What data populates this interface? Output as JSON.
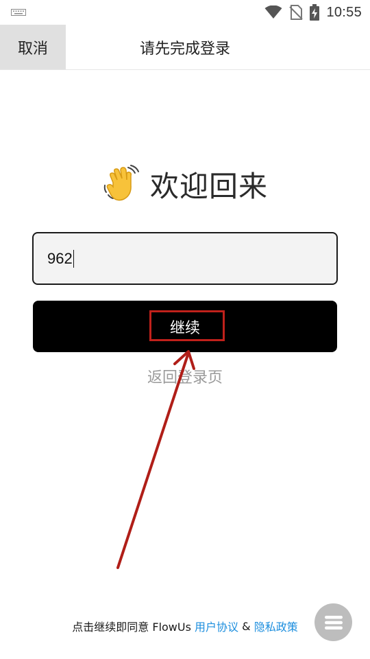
{
  "status_bar": {
    "time": "10:55",
    "icons": [
      "keyboard-icon",
      "wifi-icon",
      "no-sim-icon",
      "battery-charging-icon"
    ]
  },
  "nav": {
    "cancel_label": "取消",
    "title": "请先完成登录"
  },
  "welcome": {
    "emoji": "waving-hand-icon",
    "text": "欢迎回来"
  },
  "code_input": {
    "value": "962"
  },
  "continue_button": {
    "label": "继续"
  },
  "back_link": "返回登录页",
  "footer": {
    "prefix": "点击继续即同意 FlowUs ",
    "user_agreement": "用户协议",
    "ampersand": " & ",
    "privacy_policy": "隐私政策"
  },
  "annotation": {
    "color": "#c0211b"
  },
  "colors": {
    "link": "#1c8ede",
    "button_bg": "#000000",
    "input_bg": "#f3f3f3"
  }
}
